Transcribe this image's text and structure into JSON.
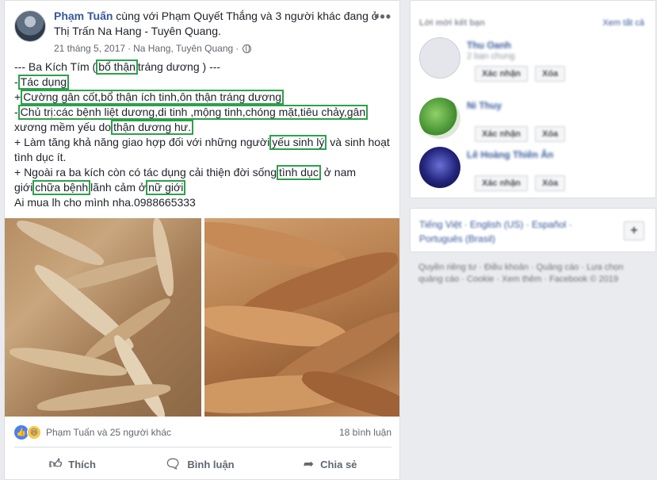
{
  "post": {
    "author": "Phạm Tuấn",
    "with_text": " cùng với Phạm Quyết Thắng và 3 người khác đang ở Thị Trấn Na Hang - Tuyên Quang.",
    "date": "21 tháng 5, 2017",
    "location": "Na Hang, Tuyên Quang",
    "more_icon": "more-dots-icon",
    "privacy_icon": "globe-icon",
    "body": {
      "l1_pre": "--- Ba Kích Tím (",
      "l1_hl": "bổ thận",
      "l1_post": "tráng dương ) ---",
      "l2_pre": "-",
      "l2_hl": "Tác dụng",
      "l3_pre": "+",
      "l3_hl": "Cường gân cốt,bổ thận ích tinh,ôn thận tráng dương",
      "l4_pre": "-",
      "l4_hl": "Chủ trị:các bệnh liệt dương,di tinh ,mộng tinh,chóng mặt,tiêu chảy,gân",
      "l5_pre": "xương mềm yếu do",
      "l5_hl": "thận dương hư.",
      "l6_pre": "+ Làm tăng khả năng giao hợp đối với những người",
      "l6_hl": "yếu sinh lý",
      "l6_post": "và sinh hoạt",
      "l7": "tình dục ít.",
      "l8_pre": "+ Ngoài ra ba kích còn có tác dụng cải thiện đời sống",
      "l8_hl": "tình dục",
      "l8_post": "ở nam",
      "l9_pre": "giới",
      "l9_hl1": "chữa bệnh",
      "l9_mid": "lãnh cảm ở",
      "l9_hl2": "nữ giới",
      "l10": "Ai mua lh cho mình nha.0988665333"
    },
    "highlight_color": "#2ca14a",
    "reactions_text": "Phạm Tuấn và 25 người khác",
    "comments_count": "18 bình luận",
    "actions": {
      "like": "Thích",
      "comment": "Bình luận",
      "share": "Chia sẻ"
    }
  },
  "sidebar": {
    "friend_requests_title": "Lời mời kết bạn",
    "see_all": "Xem tất cả",
    "confirm_label": "Xác nhận",
    "delete_label": "Xóa",
    "friends": [
      {
        "name": "Thu Oanh",
        "sub": "2 bạn chung"
      },
      {
        "name": "Ni Thuy",
        "sub": ""
      },
      {
        "name": "Lê Hoàng Thiên Ân",
        "sub": ""
      }
    ],
    "languages": "Tiếng Việt · English (US) · Español · Português (Brasil)",
    "add_language": "+",
    "footer": "Quyền riêng tư · Điều khoản · Quảng cáo · Lựa chọn quảng cáo · Cookie · Xem thêm · Facebook © 2019"
  }
}
